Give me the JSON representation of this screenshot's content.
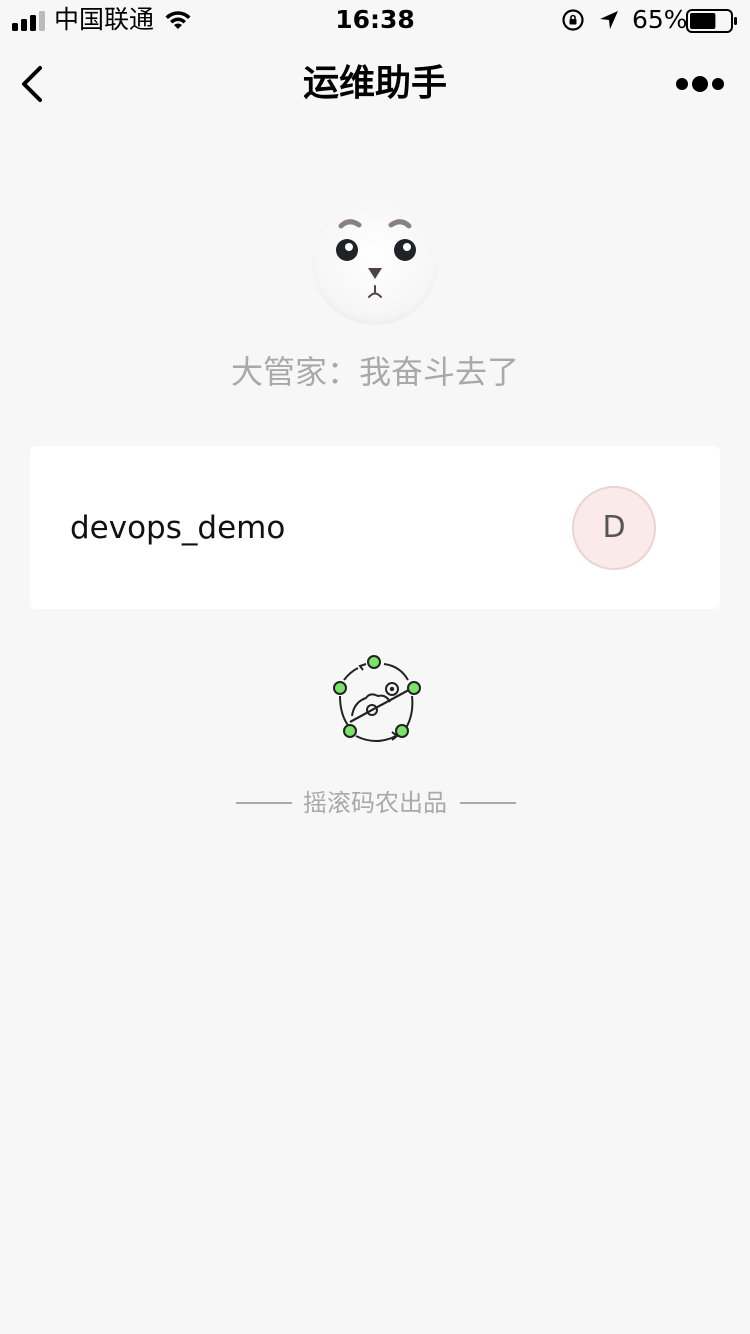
{
  "status_bar": {
    "carrier": "中国联通",
    "time": "16:38",
    "battery_percent": "65%",
    "battery_level": 0.65
  },
  "nav": {
    "title": "运维助手"
  },
  "profile": {
    "status_text": "大管家：我奋斗去了"
  },
  "project_card": {
    "name": "devops_demo",
    "badge_letter": "D",
    "badge_color": "#fbeaea"
  },
  "footer": {
    "credit": "摇滚码农出品"
  },
  "colors": {
    "background": "#f7f7f7",
    "card": "#ffffff",
    "muted_text": "#a9a9a9",
    "logo_green": "#7be26a"
  }
}
